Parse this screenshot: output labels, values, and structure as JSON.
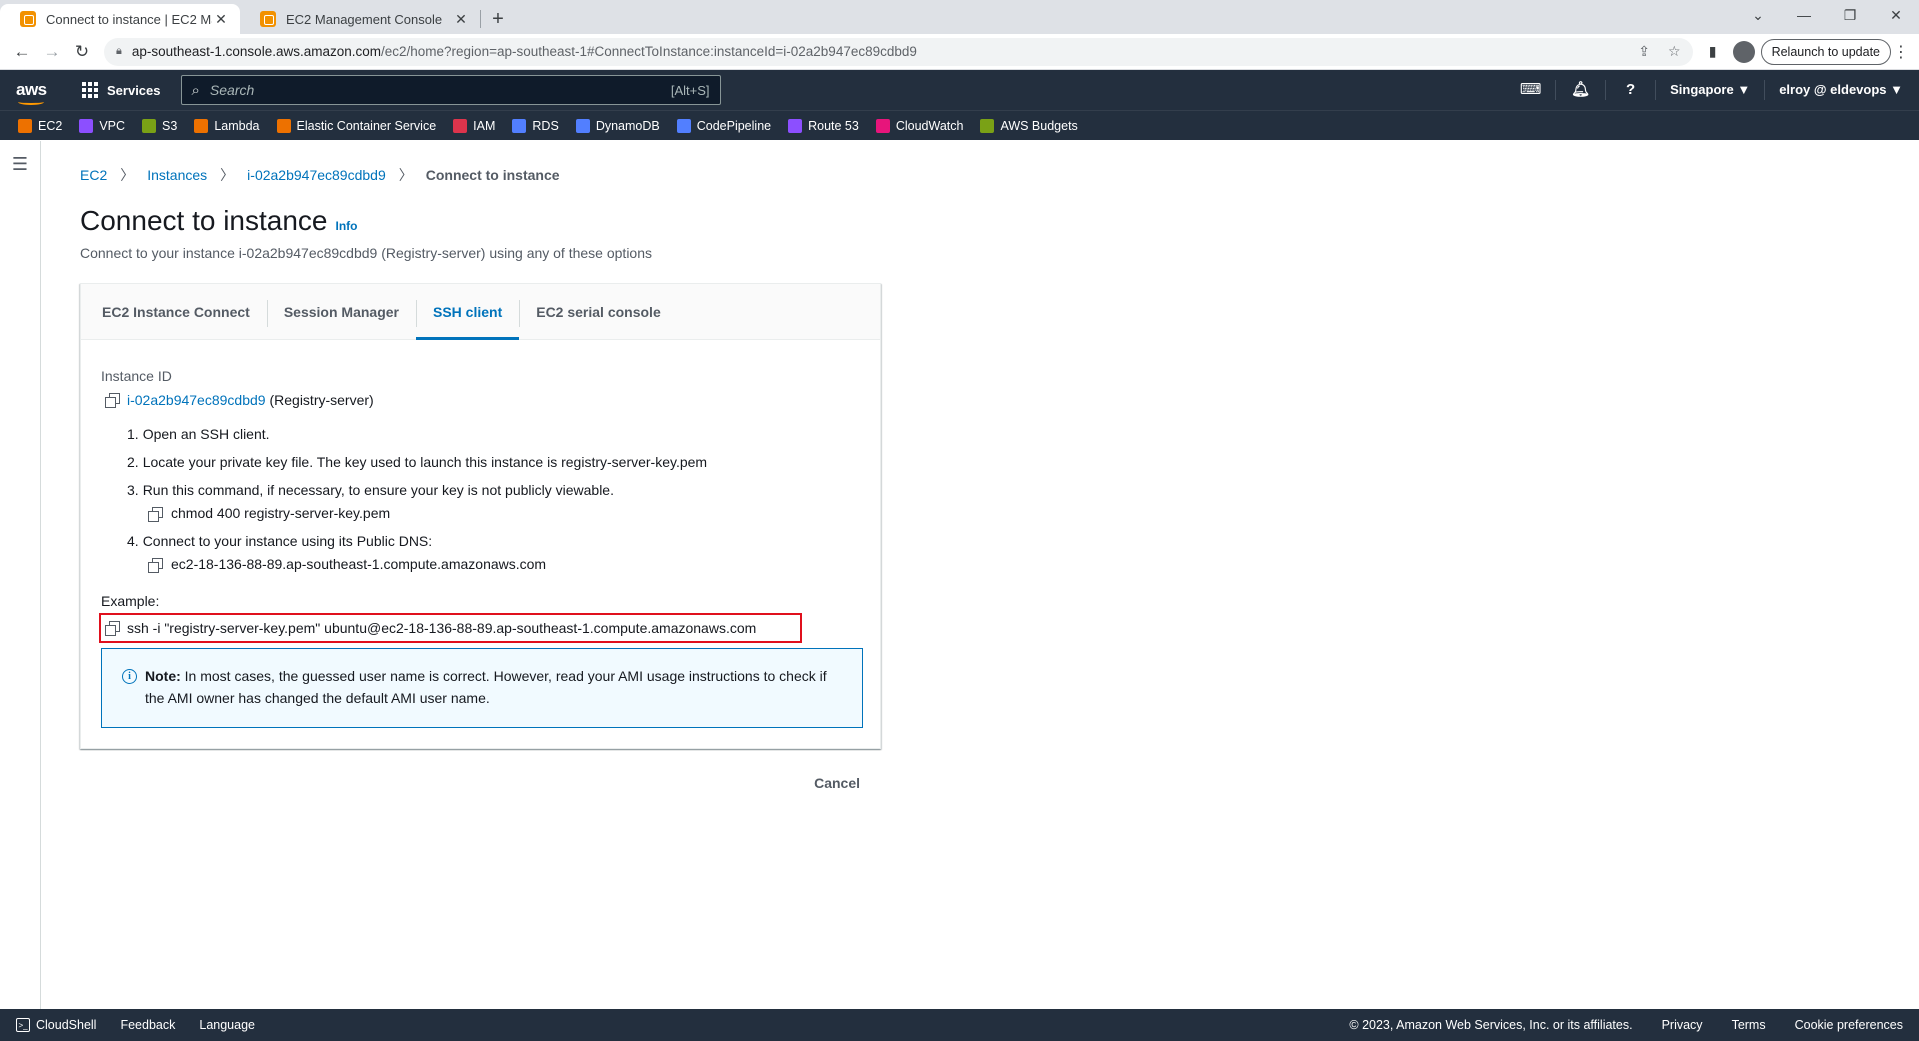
{
  "browser": {
    "tabs": [
      {
        "title": "Connect to instance | EC2 Manag",
        "active": true
      },
      {
        "title": "EC2 Management Console",
        "active": false
      }
    ],
    "url": {
      "host": "ap-southeast-1.console.aws.amazon.com",
      "path": "/ec2/home?region=ap-southeast-1#ConnectToInstance:instanceId=i-02a2b947ec89cdbd9"
    },
    "relaunch_label": "Relaunch to update"
  },
  "aws_nav": {
    "logo": "aws",
    "services_label": "Services",
    "search_placeholder": "Search",
    "search_shortcut": "[Alt+S]",
    "region": "Singapore ▼",
    "account": "elroy @ eldevops ▼"
  },
  "favorites": [
    {
      "label": "EC2",
      "color": "#ed7100"
    },
    {
      "label": "VPC",
      "color": "#8c4fff"
    },
    {
      "label": "S3",
      "color": "#7aa116"
    },
    {
      "label": "Lambda",
      "color": "#ed7100"
    },
    {
      "label": "Elastic Container Service",
      "color": "#ed7100"
    },
    {
      "label": "IAM",
      "color": "#dd344c"
    },
    {
      "label": "RDS",
      "color": "#527fff"
    },
    {
      "label": "DynamoDB",
      "color": "#527fff"
    },
    {
      "label": "CodePipeline",
      "color": "#527fff"
    },
    {
      "label": "Route 53",
      "color": "#8c4fff"
    },
    {
      "label": "CloudWatch",
      "color": "#e7157b"
    },
    {
      "label": "AWS Budgets",
      "color": "#7aa116"
    }
  ],
  "breadcrumb": {
    "items": [
      "EC2",
      "Instances",
      "i-02a2b947ec89cdbd9"
    ],
    "current": "Connect to instance"
  },
  "page": {
    "title": "Connect to instance",
    "info": "Info",
    "subtitle": "Connect to your instance i-02a2b947ec89cdbd9 (Registry-server) using any of these options"
  },
  "tabs": [
    {
      "label": "EC2 Instance Connect",
      "active": false
    },
    {
      "label": "Session Manager",
      "active": false
    },
    {
      "label": "SSH client",
      "active": true
    },
    {
      "label": "EC2 serial console",
      "active": false
    }
  ],
  "ssh": {
    "instance_id_label": "Instance ID",
    "instance_id": "i-02a2b947ec89cdbd9",
    "instance_name": "(Registry-server)",
    "steps": [
      {
        "num": "1.",
        "text": "Open an SSH client."
      },
      {
        "num": "2.",
        "text": "Locate your private key file. The key used to launch this instance is registry-server-key.pem"
      },
      {
        "num": "3.",
        "text": "Run this command, if necessary, to ensure your key is not publicly viewable.",
        "command": "chmod 400 registry-server-key.pem"
      },
      {
        "num": "4.",
        "text": "Connect to your instance using its Public DNS:",
        "command": "ec2-18-136-88-89.ap-southeast-1.compute.amazonaws.com"
      }
    ],
    "example_label": "Example:",
    "example_command": "ssh -i \"registry-server-key.pem\" ubuntu@ec2-18-136-88-89.ap-southeast-1.compute.amazonaws.com",
    "note_label": "Note:",
    "note_text": " In most cases, the guessed user name is correct. However, read your AMI usage instructions to check if the AMI owner has changed the default AMI user name."
  },
  "cancel_label": "Cancel",
  "footer": {
    "cloudshell": "CloudShell",
    "feedback": "Feedback",
    "language": "Language",
    "copyright": "© 2023, Amazon Web Services, Inc. or its affiliates.",
    "privacy": "Privacy",
    "terms": "Terms",
    "cookies": "Cookie preferences"
  }
}
